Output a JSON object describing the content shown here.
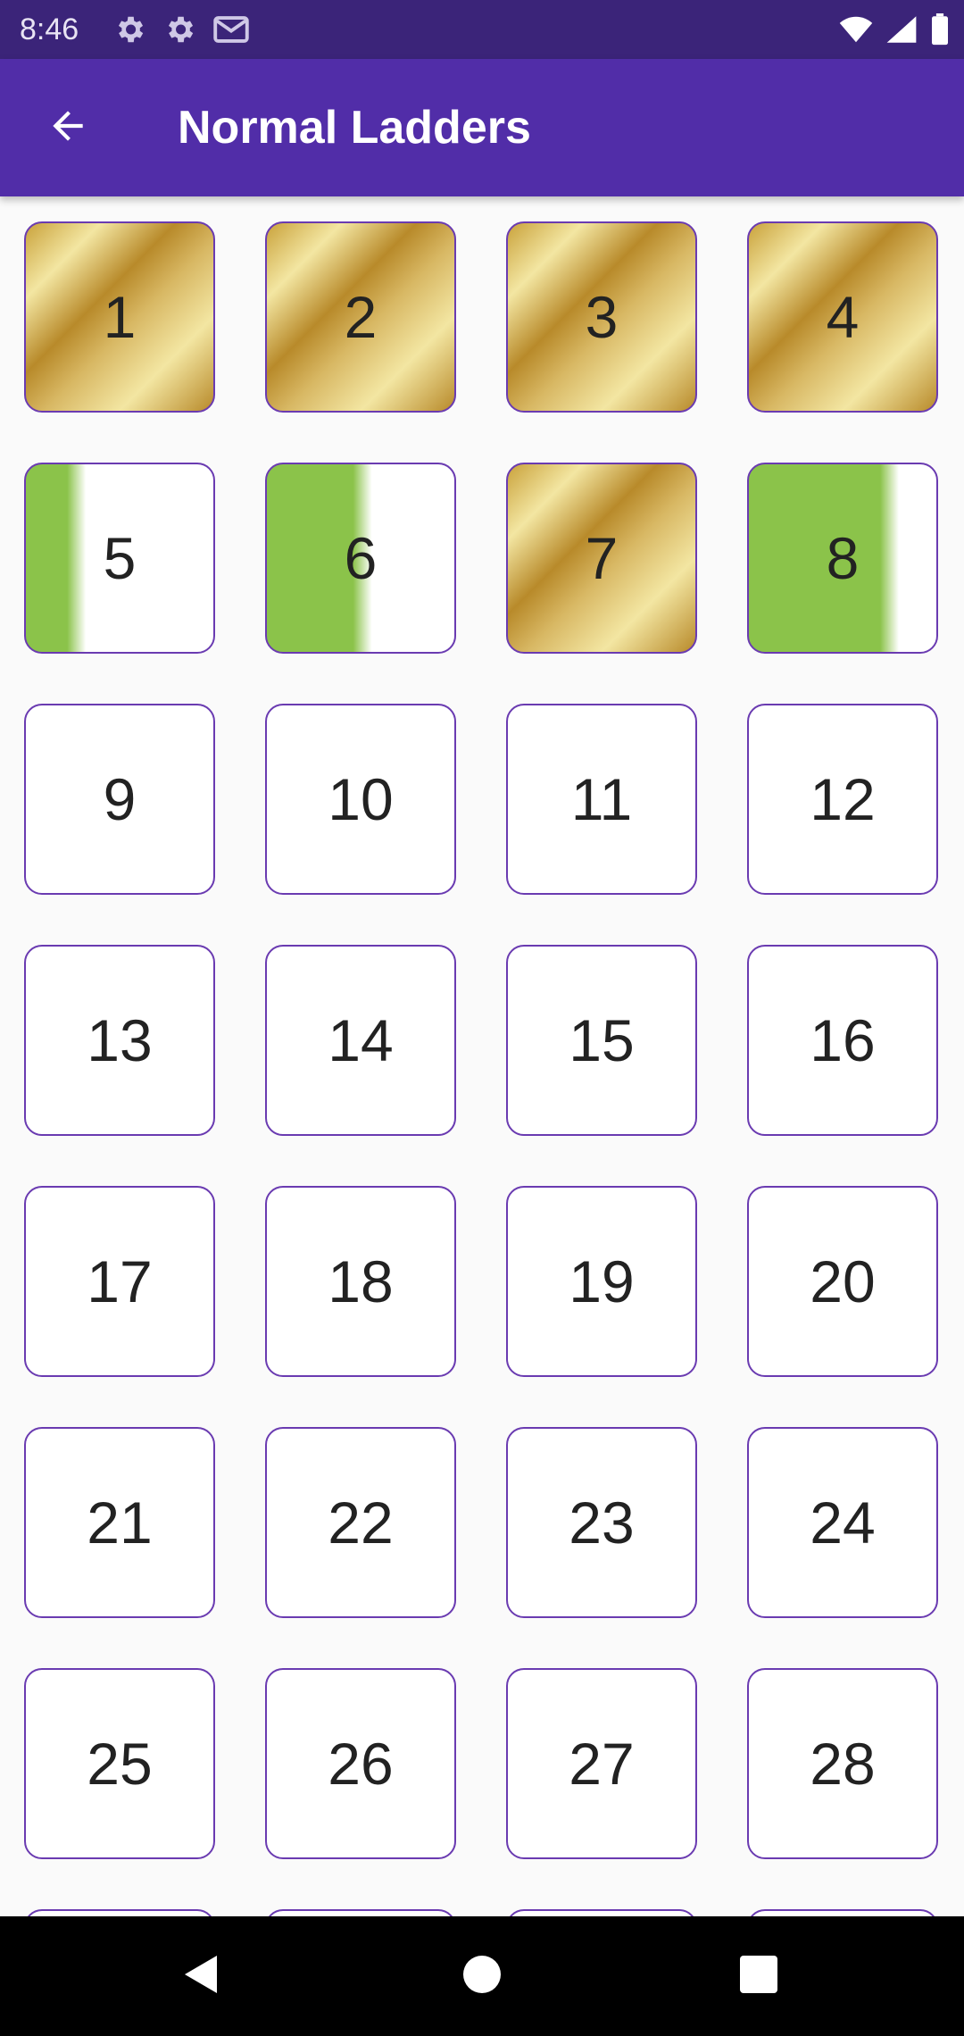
{
  "status_bar": {
    "time": "8:46",
    "left_icons": [
      "gear-icon",
      "gear-icon",
      "gmail-icon"
    ],
    "right_icons": [
      "wifi-icon",
      "signal-icon",
      "battery-icon"
    ],
    "background": "#3b2479"
  },
  "app_bar": {
    "title": "Normal Ladders",
    "back_icon": "arrow-back-icon",
    "background": "#512da8"
  },
  "colors": {
    "tile_border": "#6a3bb1",
    "progress_green": "#8bc34a",
    "gold_light": "#f3e6a2",
    "gold_dark": "#b88a2a"
  },
  "ladders": [
    {
      "number": "1",
      "status": "complete"
    },
    {
      "number": "2",
      "status": "complete"
    },
    {
      "number": "3",
      "status": "complete"
    },
    {
      "number": "4",
      "status": "complete"
    },
    {
      "number": "5",
      "status": "in-progress",
      "progress_percent": 25
    },
    {
      "number": "6",
      "status": "in-progress",
      "progress_percent": 50
    },
    {
      "number": "7",
      "status": "complete"
    },
    {
      "number": "8",
      "status": "in-progress",
      "progress_percent": 75
    },
    {
      "number": "9",
      "status": "not-started"
    },
    {
      "number": "10",
      "status": "not-started"
    },
    {
      "number": "11",
      "status": "not-started"
    },
    {
      "number": "12",
      "status": "not-started"
    },
    {
      "number": "13",
      "status": "not-started"
    },
    {
      "number": "14",
      "status": "not-started"
    },
    {
      "number": "15",
      "status": "not-started"
    },
    {
      "number": "16",
      "status": "not-started"
    },
    {
      "number": "17",
      "status": "not-started"
    },
    {
      "number": "18",
      "status": "not-started"
    },
    {
      "number": "19",
      "status": "not-started"
    },
    {
      "number": "20",
      "status": "not-started"
    },
    {
      "number": "21",
      "status": "not-started"
    },
    {
      "number": "22",
      "status": "not-started"
    },
    {
      "number": "23",
      "status": "not-started"
    },
    {
      "number": "24",
      "status": "not-started"
    },
    {
      "number": "25",
      "status": "not-started"
    },
    {
      "number": "26",
      "status": "not-started"
    },
    {
      "number": "27",
      "status": "not-started"
    },
    {
      "number": "28",
      "status": "not-started"
    },
    {
      "number": "",
      "status": "not-started"
    },
    {
      "number": "",
      "status": "not-started"
    },
    {
      "number": "",
      "status": "not-started"
    },
    {
      "number": "",
      "status": "not-started"
    }
  ],
  "nav_bar": {
    "icons": [
      "back-triangle-icon",
      "home-circle-icon",
      "recents-square-icon"
    ]
  }
}
